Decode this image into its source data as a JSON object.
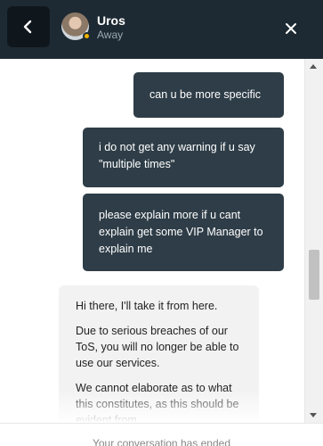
{
  "header": {
    "agent_name": "Uros",
    "agent_status": "Away",
    "icons": {
      "back": "chevron-left-icon",
      "close": "close-icon"
    },
    "colors": {
      "background": "#1e2a33",
      "status_away": "#f0b400"
    }
  },
  "messages": [
    {
      "direction": "outgoing",
      "text": "can u be more specific"
    },
    {
      "direction": "outgoing",
      "text": "i do not get any warning if u say \"multiple times\""
    },
    {
      "direction": "outgoing",
      "text": "please explain more if u cant explain get some VIP Manager to explain me"
    },
    {
      "direction": "incoming",
      "paragraphs": [
        "Hi there, I'll take it from here.",
        "Due to serious breaches of our ToS, you will no longer be able to use our services.",
        "We cannot elaborate as to what this constitutes, as this should be evident from"
      ]
    }
  ],
  "footer": {
    "ended_text": "Your conversation has ended"
  }
}
